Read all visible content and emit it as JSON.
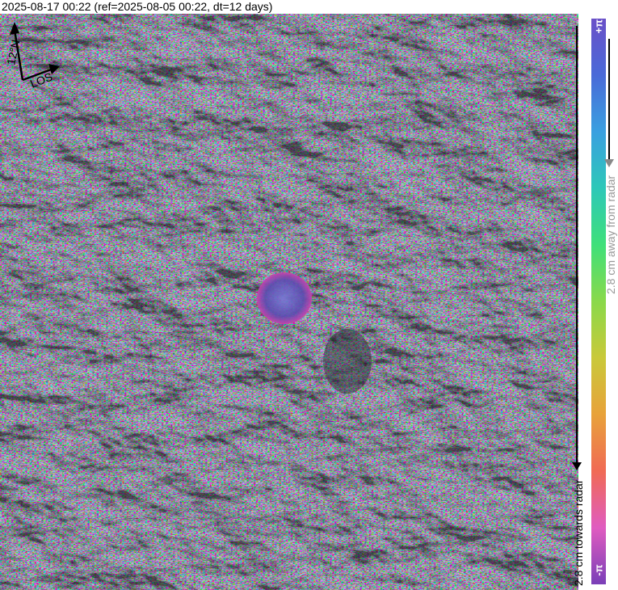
{
  "title": "2025-08-17 00:22 (ref=2025-08-05 00:22, dt=12 days)",
  "north_arrow": {
    "angle_label": "12°N",
    "los_label": "LOS"
  },
  "colorbar": {
    "top_label": "+π",
    "bottom_label": "-π",
    "away_label": "2.8 cm away from radar",
    "towards_label": "2.8 cm towards radar",
    "colors": [
      "#7a3fb8",
      "#e05cc0",
      "#f06a55",
      "#e8a23a",
      "#c9c93a",
      "#8ad94a",
      "#3fe07a",
      "#2dc8b8",
      "#3aa0e0",
      "#4a6ad8",
      "#6a50c8"
    ]
  }
}
